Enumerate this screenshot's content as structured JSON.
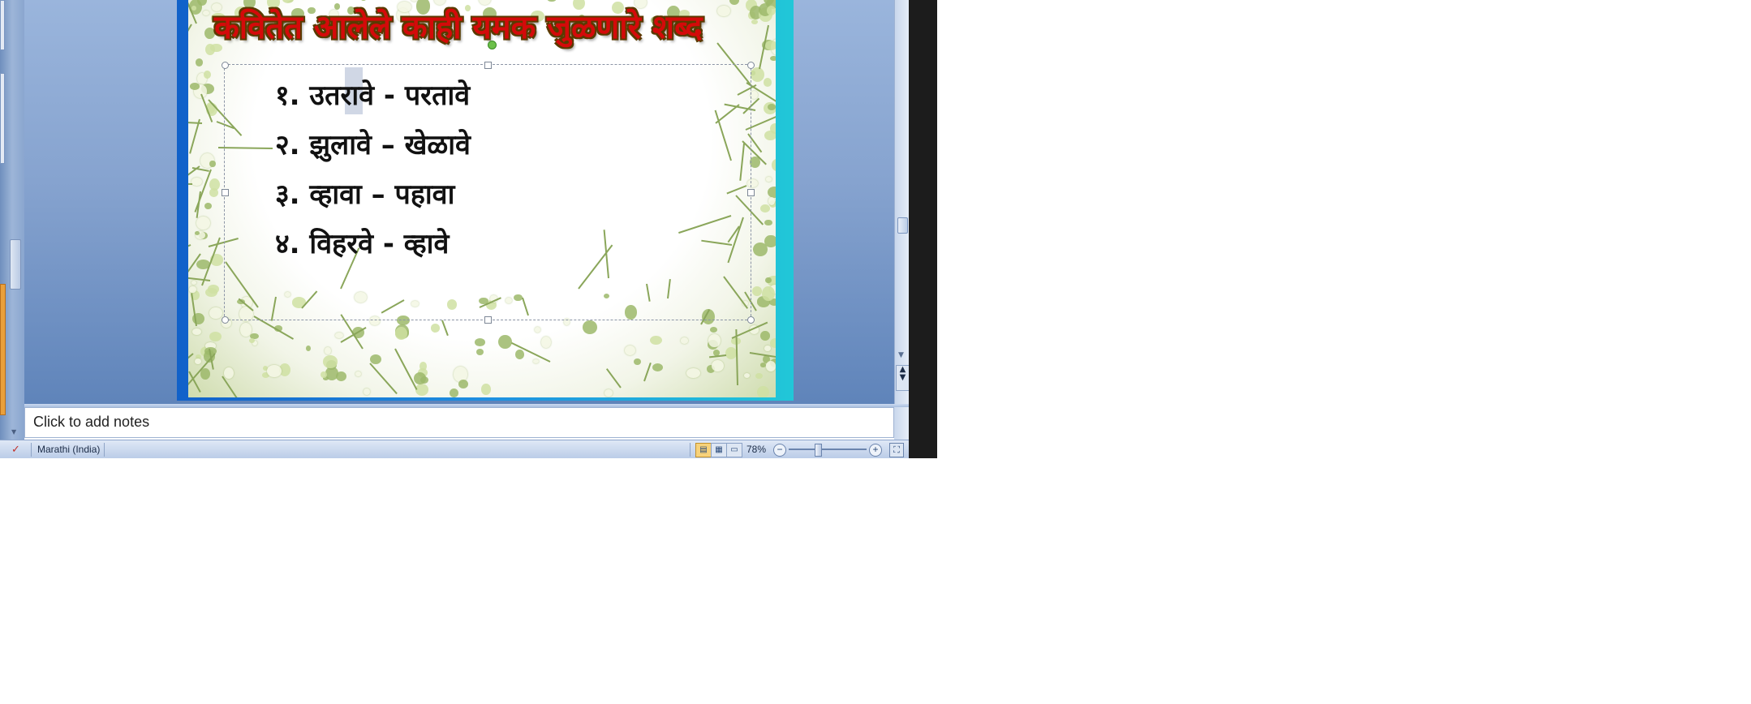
{
  "slide": {
    "title": "कवितेत आलेले काही यमक जुळणारे शब्द",
    "items": [
      "१. उतरावे - परतावे",
      "२. झुलावे – खेळावे",
      "३. व्हावा – पहावा",
      "४. विहरवे - व्हावे"
    ]
  },
  "notes": {
    "placeholder": "Click to add notes"
  },
  "status_bar": {
    "language": "Marathi (India)",
    "zoom_level": "78%",
    "zoom_fraction": 0.78
  },
  "icons": {
    "spell_check": "spell-check-icon",
    "normal_view": "normal-view-icon",
    "slide_sorter": "slide-sorter-icon",
    "slide_show": "slide-show-icon",
    "zoom_out": "zoom-out-icon",
    "zoom_in": "zoom-in-icon",
    "fit_window": "fit-to-window-icon"
  },
  "colors": {
    "title": "#d40a0a",
    "canvas": "#86a3cf",
    "slide_border": "#1e8fe0",
    "active_view": "#f7d27a"
  }
}
